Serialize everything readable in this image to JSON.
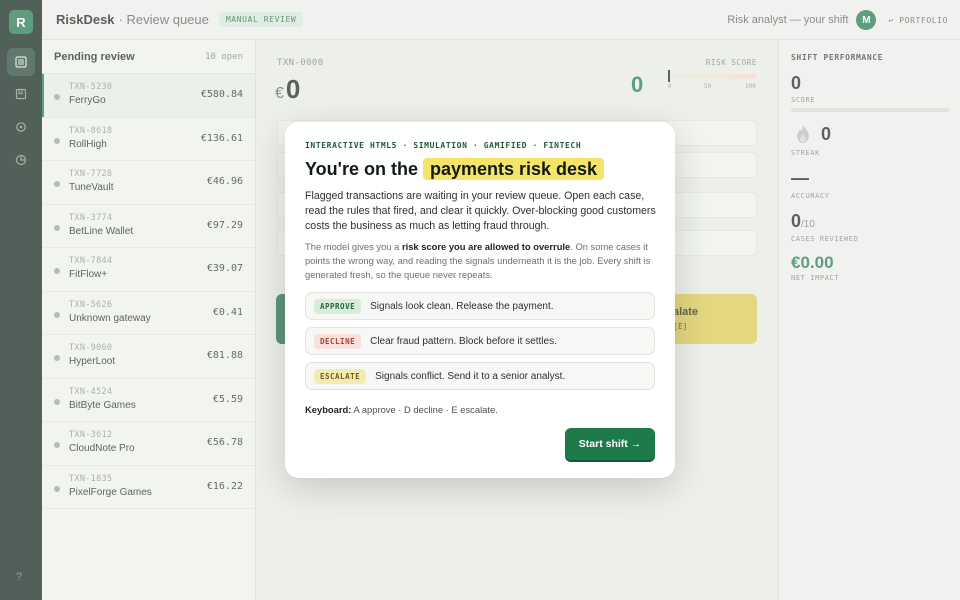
{
  "app": {
    "logo_letter": "R",
    "name": "RiskDesk",
    "section": "· Review queue",
    "mode_badge": "MANUAL REVIEW",
    "analyst": "Risk analyst — your shift",
    "avatar_letter": "M",
    "portfolio": "↩ PORTFOLIO",
    "help": "?"
  },
  "rail_icons": [
    "queue-icon",
    "bookmark-icon",
    "settings-icon",
    "chart-icon"
  ],
  "queue": {
    "title": "Pending review",
    "count": "10 open",
    "items": [
      {
        "id": "TXN-5230",
        "name": "FerryGo",
        "amount": "€580.84"
      },
      {
        "id": "TXN-8618",
        "name": "RollHigh",
        "amount": "€136.61"
      },
      {
        "id": "TXN-7728",
        "name": "TuneVault",
        "amount": "€46.96"
      },
      {
        "id": "TXN-3774",
        "name": "BetLine Wallet",
        "amount": "€97.29"
      },
      {
        "id": "TXN-7844",
        "name": "FitFlow+",
        "amount": "€39.07"
      },
      {
        "id": "TXN-5626",
        "name": "Unknown gateway",
        "amount": "€0.41"
      },
      {
        "id": "TXN-9060",
        "name": "HyperLoot",
        "amount": "€81.88"
      },
      {
        "id": "TXN-4524",
        "name": "BitByte Games",
        "amount": "€5.59"
      },
      {
        "id": "TXN-3612",
        "name": "CloudNote Pro",
        "amount": "€56.78"
      },
      {
        "id": "TXN-1835",
        "name": "PixelForge Games",
        "amount": "€16.22"
      }
    ]
  },
  "case": {
    "id": "TXN-0000",
    "currency": "€",
    "amount": "0",
    "risk_score": "0",
    "risk_label": "RISK SCORE",
    "ticks": [
      "0",
      "50",
      "100"
    ],
    "escalate_label": "alate",
    "escalate_key": "[E]"
  },
  "stats": {
    "title": "SHIFT PERFORMANCE",
    "score_value": "0",
    "score_label": "SCORE",
    "streak_value": "0",
    "streak_label": "STREAK",
    "accuracy_value": "—",
    "accuracy_label": "ACCURACY",
    "reviewed_value": "0",
    "reviewed_total": "/10",
    "reviewed_label": "CASES REVIEWED",
    "impact_value": "€0.00",
    "impact_label": "NET IMPACT"
  },
  "modal": {
    "eyebrow": "INTERACTIVE HTML5 · SIMULATION · GAMIFIED · FINTECH",
    "title_prefix": "You're on the ",
    "title_highlight": "payments risk desk",
    "p1": "Flagged transactions are waiting in your review queue. Open each case, read the rules that fired, and clear it quickly. Over-blocking good customers costs the business as much as letting fraud through.",
    "p2_before": "The model gives you a ",
    "p2_bold": "risk score you are allowed to overrule",
    "p2_after": ". On some cases it points the wrong way, and reading the signals underneath it is the job. Every shift is generated fresh, so the queue never repeats.",
    "options": [
      {
        "chip": "APPROVE",
        "text": "Signals look clean. Release the payment."
      },
      {
        "chip": "DECLINE",
        "text": "Clear fraud pattern. Block before it settles."
      },
      {
        "chip": "ESCALATE",
        "text": "Signals conflict. Send it to a senior analyst."
      }
    ],
    "keys_label": "Keyboard:",
    "keys_text": " A approve · D decline · E escalate.",
    "start_label": "Start shift →"
  },
  "colors": {
    "brand_green": "#1f7a4a",
    "rail_bg": "#0e2519",
    "highlight": "#f6e46a",
    "escalate_yellow": "#d9c84e"
  }
}
